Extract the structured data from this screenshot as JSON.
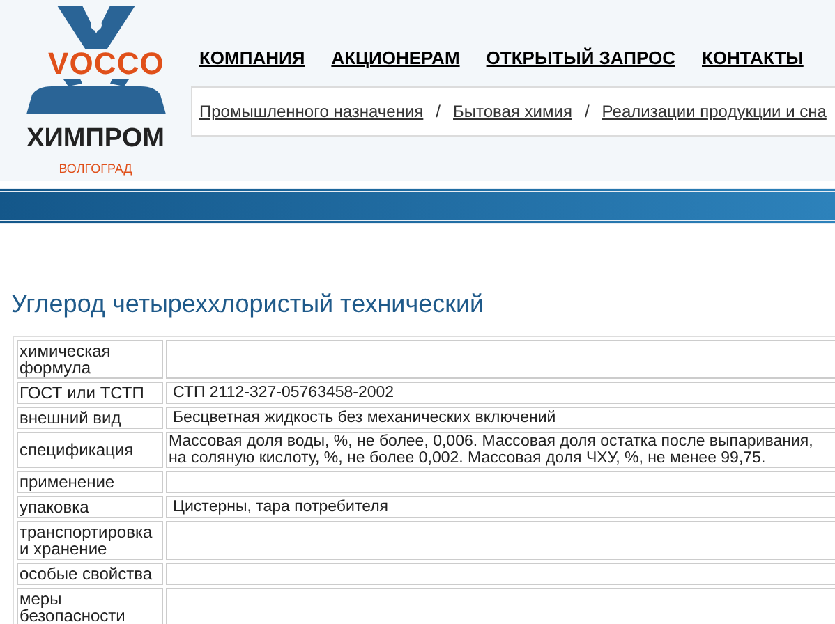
{
  "logo": {
    "brand": "VOCCO",
    "name": "ХИМПРОМ",
    "city": "ВОЛГОГРАД"
  },
  "nav": [
    "КОМПАНИЯ",
    "АКЦИОНЕРАМ",
    "ОТКРЫТЫЙ ЗАПРОС",
    "КОНТАКТЫ"
  ],
  "breadcrumbs": {
    "separator": "/",
    "items": [
      "Промышленного назначения",
      "Бытовая химия",
      "Реализации продукции и сна"
    ]
  },
  "title": "Углерод четыреххлористый технический",
  "table": {
    "rows": [
      {
        "label": "химическая формула",
        "value": []
      },
      {
        "label": "ГОСТ или ТСТП",
        "value": [
          "СТП 2112-327-05763458-2002"
        ]
      },
      {
        "label": "внешний вид",
        "value": [
          "Бесцветная жидкость без механических включений"
        ]
      },
      {
        "label": "спецификация",
        "value": [
          "Массовая доля воды, %, не более, 0,006. Массовая доля остатка после выпаривания,",
          "на соляную кислоту, %, не более 0,002. Массовая доля ЧХУ, %, не менее 99,75."
        ]
      },
      {
        "label": "применение",
        "value": []
      },
      {
        "label": "упаковка",
        "value": [
          "Цистерны, тара потребителя"
        ]
      },
      {
        "label": "транспортировка и хранение",
        "value": []
      },
      {
        "label": "особые свойства",
        "value": []
      },
      {
        "label": "меры безопасности",
        "value": []
      }
    ]
  }
}
